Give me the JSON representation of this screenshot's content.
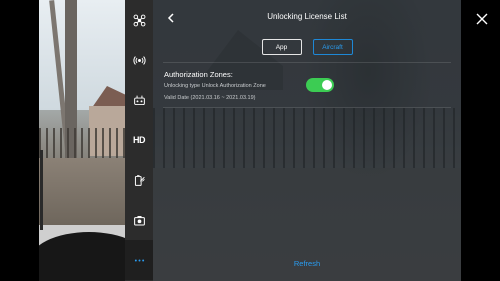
{
  "header": {
    "title": "Unlocking License List"
  },
  "tabs": [
    {
      "label": "App",
      "selected": false
    },
    {
      "label": "Aircraft",
      "selected": true
    }
  ],
  "zones": {
    "title": "Authorization Zones:",
    "type_text": "Unlocking type Unlock Authorization Zone",
    "date_text": "Valid Date  (2021.03.16 ~ 2021.03.19)",
    "enabled": true
  },
  "footer": {
    "refresh_label": "Refresh"
  },
  "sidebar": {
    "items": [
      {
        "icon": "drone-icon"
      },
      {
        "icon": "signal-icon"
      },
      {
        "icon": "remote-controller-icon"
      },
      {
        "icon": "hd-icon",
        "label": "HD"
      },
      {
        "icon": "battery-icon"
      },
      {
        "icon": "camera-icon"
      },
      {
        "icon": "more-icon",
        "active": true
      }
    ]
  },
  "colors": {
    "accent_blue": "#2a9cf0",
    "switch_green": "#3ccc53",
    "sidebar_bg": "#2c2c2c"
  }
}
